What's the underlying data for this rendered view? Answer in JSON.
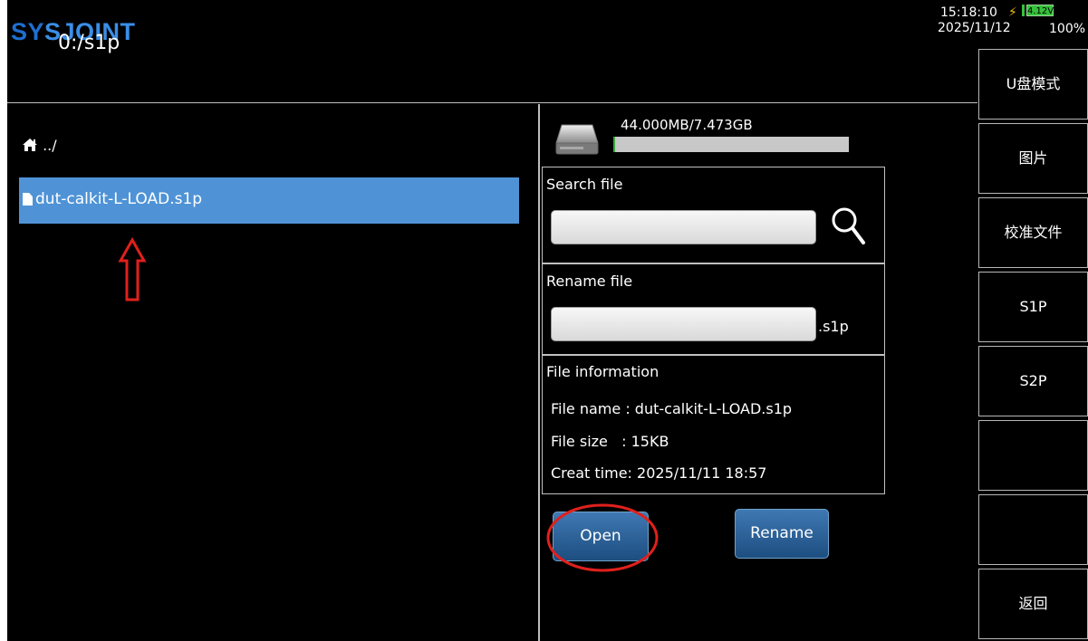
{
  "header": {
    "logo_sy": "SY",
    "logo_rest": "SJOINT",
    "path": "0:/s1p",
    "time": "15:18:10",
    "voltage": "4.12V",
    "date": "2025/11/12",
    "battery_percent": "100%"
  },
  "file_list": {
    "parent_label": "../",
    "items": [
      {
        "name": "dut-calkit-L-LOAD.s1p",
        "selected": true
      }
    ]
  },
  "storage": {
    "text": "44.000MB/7.473GB",
    "used_fraction": 0.006
  },
  "search": {
    "title": "Search file",
    "value": ""
  },
  "rename": {
    "title": "Rename file",
    "value": "",
    "extension": ".s1p"
  },
  "info": {
    "title": "File information",
    "name_line": "File name : dut-calkit-L-LOAD.s1p",
    "size_line": "File size   : 15KB",
    "time_line": "Creat time: 2025/11/11 18:57"
  },
  "buttons": {
    "open": "Open",
    "rename": "Rename"
  },
  "softkeys": [
    "U盘模式",
    "图片",
    "校准文件",
    "S1P",
    "S2P",
    "",
    "",
    "返回"
  ],
  "colors": {
    "selection": "#4f93d6",
    "button": "#2a5f97",
    "annotation": "#e0201c"
  }
}
